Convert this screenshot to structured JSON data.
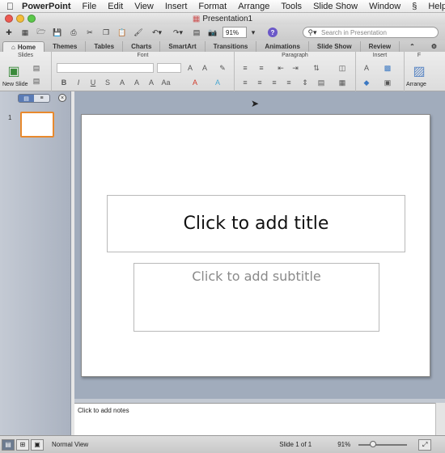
{
  "menubar": {
    "app": "PowerPoint",
    "items": [
      "File",
      "Edit",
      "View",
      "Insert",
      "Format",
      "Arrange",
      "Tools",
      "Slide Show",
      "Window",
      "Help"
    ]
  },
  "window": {
    "title": "Presentation1"
  },
  "toolbar": {
    "zoom": "91%",
    "search_placeholder": "Search in Presentation"
  },
  "ribbon": {
    "tabs": [
      "Home",
      "Themes",
      "Tables",
      "Charts",
      "SmartArt",
      "Transitions",
      "Animations",
      "Slide Show",
      "Review"
    ],
    "groups": {
      "slides": "Slides",
      "font": "Font",
      "paragraph": "Paragraph",
      "insert": "Insert",
      "format": "F"
    },
    "new_slide": "New Slide",
    "arrange": "Arrange"
  },
  "slides_pane": {
    "slide_number": "1"
  },
  "slide": {
    "title_placeholder": "Click to add title",
    "subtitle_placeholder": "Click to add subtitle"
  },
  "notes": {
    "placeholder": "Click to add notes"
  },
  "status": {
    "view": "Normal View",
    "slide_info": "Slide 1 of 1",
    "zoom": "91%"
  }
}
